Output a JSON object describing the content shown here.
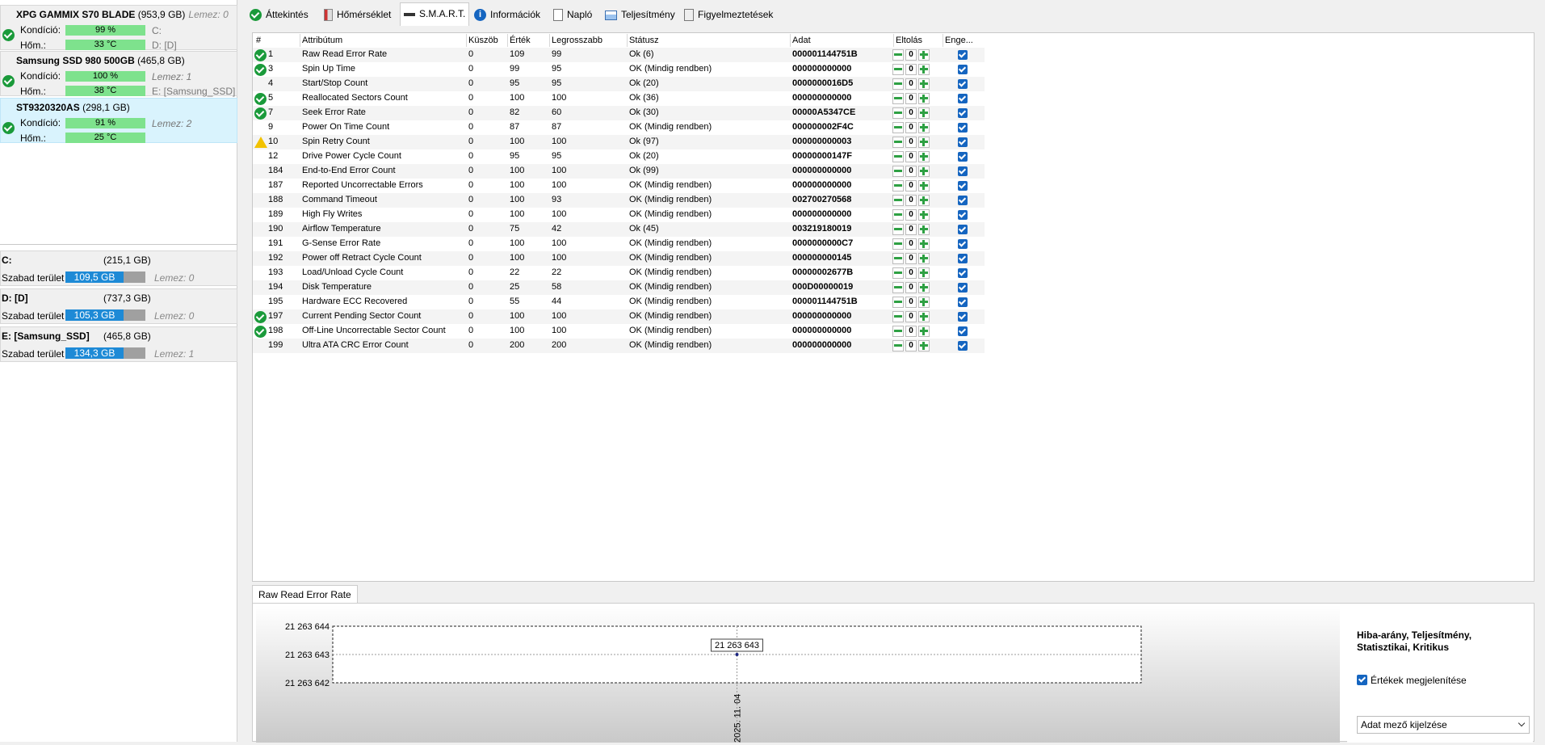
{
  "disks": [
    {
      "name": "XPG GAMMIX S70 BLADE",
      "size": "(953,9 GB)",
      "lemez": "Lemez: 0",
      "kondicio_label": "Kondíció:",
      "kondicio": "99 %",
      "hom_label": "Hőm.:",
      "hom": "33 °C",
      "side1": "C:",
      "side2": "D: [D]"
    },
    {
      "name": "Samsung SSD 980 500GB",
      "size": "(465,8 GB)",
      "lemez": "",
      "kondicio_label": "Kondíció:",
      "kondicio": "100 %",
      "hom_label": "Hőm.:",
      "hom": "38 °C",
      "side1": "Lemez: 1",
      "side2": "E: [Samsung_SSD]"
    },
    {
      "name": "ST9320320AS",
      "size": "(298,1 GB)",
      "lemez": "",
      "kondicio_label": "Kondíció:",
      "kondicio": "91 %",
      "hom_label": "Hőm.:",
      "hom": "25 °C",
      "side1": "Lemez: 2",
      "side2": ""
    }
  ],
  "volumes": [
    {
      "name": "C:",
      "size": "(215,1 GB)",
      "label": "Szabad terület",
      "free": "109,5 GB",
      "fill_percent": 51,
      "lemez": "Lemez: 0"
    },
    {
      "name": "D: [D]",
      "size": "(737,3 GB)",
      "label": "Szabad terület",
      "free": "105,3 GB",
      "fill_percent": 14,
      "lemez": "Lemez: 0"
    },
    {
      "name": "E: [Samsung_SSD]",
      "size": "(465,8 GB)",
      "label": "Szabad terület",
      "free": "134,3 GB",
      "fill_percent": 29,
      "lemez": "Lemez: 1"
    }
  ],
  "tabs": [
    {
      "label": "Áttekintés",
      "icon": "check-circle-icon"
    },
    {
      "label": "Hőmérséklet",
      "icon": "thermometer-icon"
    },
    {
      "label": "S.M.A.R.T.",
      "icon": "smart-icon",
      "active": true
    },
    {
      "label": "Információk",
      "icon": "info-icon"
    },
    {
      "label": "Napló",
      "icon": "document-icon"
    },
    {
      "label": "Teljesítmény",
      "icon": "performance-chart-icon"
    },
    {
      "label": "Figyelmeztetések",
      "icon": "alerts-document-icon"
    }
  ],
  "table": {
    "headers": [
      "#",
      "Attribútum",
      "Küszöb",
      "Érték",
      "Legrosszabb",
      "Státusz",
      "Adat",
      "Eltolás",
      "Enge..."
    ],
    "rows": [
      {
        "status_icon": "ok",
        "id": "1",
        "attr": "Raw Read Error Rate",
        "kuszob": "0",
        "ertek": "109",
        "legrosszabb": "99",
        "statusz": "Ok (6)",
        "adat": "000001144751B",
        "eltolas": "0"
      },
      {
        "status_icon": "ok",
        "id": "3",
        "attr": "Spin Up Time",
        "kuszob": "0",
        "ertek": "99",
        "legrosszabb": "95",
        "statusz": "OK (Mindig rendben)",
        "adat": "000000000000",
        "eltolas": "0"
      },
      {
        "status_icon": "",
        "id": "4",
        "attr": "Start/Stop Count",
        "kuszob": "0",
        "ertek": "95",
        "legrosszabb": "95",
        "statusz": "Ok (20)",
        "adat": "0000000016D5",
        "eltolas": "0"
      },
      {
        "status_icon": "ok",
        "id": "5",
        "attr": "Reallocated Sectors Count",
        "kuszob": "0",
        "ertek": "100",
        "legrosszabb": "100",
        "statusz": "Ok (36)",
        "adat": "000000000000",
        "eltolas": "0"
      },
      {
        "status_icon": "ok",
        "id": "7",
        "attr": "Seek Error Rate",
        "kuszob": "0",
        "ertek": "82",
        "legrosszabb": "60",
        "statusz": "Ok (30)",
        "adat": "00000A5347CE",
        "eltolas": "0"
      },
      {
        "status_icon": "",
        "id": "9",
        "attr": "Power On Time Count",
        "kuszob": "0",
        "ertek": "87",
        "legrosszabb": "87",
        "statusz": "OK (Mindig rendben)",
        "adat": "000000002F4C",
        "eltolas": "0"
      },
      {
        "status_icon": "warn",
        "id": "10",
        "attr": "Spin Retry Count",
        "kuszob": "0",
        "ertek": "100",
        "legrosszabb": "100",
        "statusz": "Ok (97)",
        "adat": "000000000003",
        "eltolas": "0"
      },
      {
        "status_icon": "",
        "id": "12",
        "attr": "Drive Power Cycle Count",
        "kuszob": "0",
        "ertek": "95",
        "legrosszabb": "95",
        "statusz": "Ok (20)",
        "adat": "00000000147F",
        "eltolas": "0"
      },
      {
        "status_icon": "",
        "id": "184",
        "attr": "End-to-End Error Count",
        "kuszob": "0",
        "ertek": "100",
        "legrosszabb": "100",
        "statusz": "Ok (99)",
        "adat": "000000000000",
        "eltolas": "0"
      },
      {
        "status_icon": "",
        "id": "187",
        "attr": "Reported Uncorrectable Errors",
        "kuszob": "0",
        "ertek": "100",
        "legrosszabb": "100",
        "statusz": "OK (Mindig rendben)",
        "adat": "000000000000",
        "eltolas": "0"
      },
      {
        "status_icon": "",
        "id": "188",
        "attr": "Command Timeout",
        "kuszob": "0",
        "ertek": "100",
        "legrosszabb": "93",
        "statusz": "OK (Mindig rendben)",
        "adat": "002700270568",
        "eltolas": "0"
      },
      {
        "status_icon": "",
        "id": "189",
        "attr": "High Fly Writes",
        "kuszob": "0",
        "ertek": "100",
        "legrosszabb": "100",
        "statusz": "OK (Mindig rendben)",
        "adat": "000000000000",
        "eltolas": "0"
      },
      {
        "status_icon": "",
        "id": "190",
        "attr": "Airflow Temperature",
        "kuszob": "0",
        "ertek": "75",
        "legrosszabb": "42",
        "statusz": "Ok (45)",
        "adat": "003219180019",
        "eltolas": "0"
      },
      {
        "status_icon": "",
        "id": "191",
        "attr": "G-Sense Error Rate",
        "kuszob": "0",
        "ertek": "100",
        "legrosszabb": "100",
        "statusz": "OK (Mindig rendben)",
        "adat": "0000000000C7",
        "eltolas": "0"
      },
      {
        "status_icon": "",
        "id": "192",
        "attr": "Power off Retract Cycle Count",
        "kuszob": "0",
        "ertek": "100",
        "legrosszabb": "100",
        "statusz": "OK (Mindig rendben)",
        "adat": "000000000145",
        "eltolas": "0"
      },
      {
        "status_icon": "",
        "id": "193",
        "attr": "Load/Unload Cycle Count",
        "kuszob": "0",
        "ertek": "22",
        "legrosszabb": "22",
        "statusz": "OK (Mindig rendben)",
        "adat": "00000002677B",
        "eltolas": "0"
      },
      {
        "status_icon": "",
        "id": "194",
        "attr": "Disk Temperature",
        "kuszob": "0",
        "ertek": "25",
        "legrosszabb": "58",
        "statusz": "OK (Mindig rendben)",
        "adat": "000D00000019",
        "eltolas": "0"
      },
      {
        "status_icon": "",
        "id": "195",
        "attr": "Hardware ECC Recovered",
        "kuszob": "0",
        "ertek": "55",
        "legrosszabb": "44",
        "statusz": "OK (Mindig rendben)",
        "adat": "000001144751B",
        "eltolas": "0"
      },
      {
        "status_icon": "ok",
        "id": "197",
        "attr": "Current Pending Sector Count",
        "kuszob": "0",
        "ertek": "100",
        "legrosszabb": "100",
        "statusz": "OK (Mindig rendben)",
        "adat": "000000000000",
        "eltolas": "0"
      },
      {
        "status_icon": "ok",
        "id": "198",
        "attr": "Off-Line Uncorrectable Sector Count",
        "kuszob": "0",
        "ertek": "100",
        "legrosszabb": "100",
        "statusz": "OK (Mindig rendben)",
        "adat": "000000000000",
        "eltolas": "0"
      },
      {
        "status_icon": "",
        "id": "199",
        "attr": "Ultra ATA CRC Error Count",
        "kuszob": "0",
        "ertek": "200",
        "legrosszabb": "200",
        "statusz": "OK (Mindig rendben)",
        "adat": "000000000000",
        "eltolas": "0"
      }
    ]
  },
  "bottom": {
    "tab_label": "Raw Read Error Rate",
    "right_panel": {
      "title": "Hiba-arány, Teljesítmény, Statisztikai, Kritikus",
      "checkbox_label": "Értékek megjelenítése",
      "select_value": "Adat mező kijelzése"
    }
  },
  "chart_data": {
    "type": "line",
    "title": "",
    "xlabel": "",
    "ylabel": "",
    "x": [
      "2025. 11. 04"
    ],
    "series": [
      {
        "values": [
          21263643
        ]
      }
    ],
    "ylim": [
      21263642,
      21263644
    ],
    "ytick_labels": [
      "21 263 644",
      "21 263 643",
      "21 263 642"
    ],
    "data_labels": [
      "21 263 643"
    ],
    "grid": true
  },
  "colors": {
    "accent": "#1e8ad6",
    "ok_green": "#1a9a3a",
    "health_bar": "#7ee28d",
    "warn": "#f2c200",
    "selected_disk": "#d9f3fd"
  }
}
